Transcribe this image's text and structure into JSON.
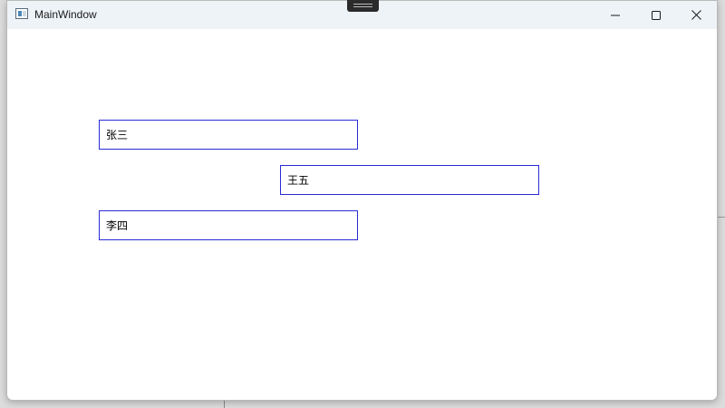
{
  "window": {
    "title": "MainWindow"
  },
  "controls": {
    "minimize_icon": "minimize-icon",
    "maximize_icon": "maximize-icon",
    "close_icon": "close-icon"
  },
  "fields": [
    {
      "value": "张三"
    },
    {
      "value": "王五"
    },
    {
      "value": "李四"
    }
  ],
  "colors": {
    "titlebar": "#eef3f8",
    "textbox_border": "#2a2ad8",
    "window_bg": "#ffffff"
  }
}
